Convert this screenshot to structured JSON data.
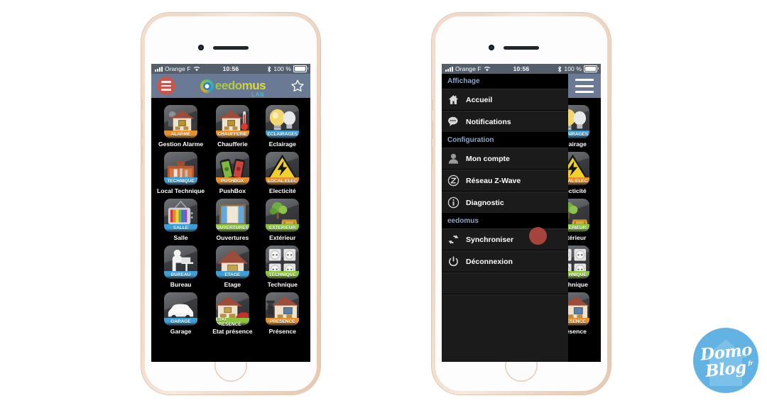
{
  "status_bar": {
    "carrier": "Orange F",
    "time": "10:56",
    "battery_pct": "100 %",
    "wifi_icon": "wifi-icon",
    "bluetooth_icon": "bluetooth-icon",
    "signal_icon": "signal-bars-icon",
    "battery_icon": "battery-icon"
  },
  "app_bar": {
    "menu_icon": "hamburger-menu-icon",
    "brand": "eedomus",
    "brand_sub": "LAN",
    "favorite_icon": "star-icon"
  },
  "colors": {
    "app_bar_bg": "#6b7a94",
    "status_bar_bg": "#555e6b",
    "menu_button_red": "#c7564f",
    "screen_bg": "#000000",
    "menu_row_bg": "#1b1b1b",
    "menu_section_text": "#8ea6c8",
    "touch_indicator": "#b0463e",
    "watermark_bg": "#62b2e4",
    "phone_body": "#f0dbca"
  },
  "tiles": [
    {
      "caption": "Gestion Alarme",
      "band": "ALARME",
      "band_color": "#e8902b",
      "art": "house-burglar-icon"
    },
    {
      "caption": "Chaufferie",
      "band": "CHAUFFERIE",
      "band_color": "#e8902b",
      "art": "house-thermometer-icon"
    },
    {
      "caption": "Eclairage",
      "band": "ECLAIRAGES",
      "band_color": "#3e9fd6",
      "art": "light-bulbs-icon"
    },
    {
      "caption": "Local Technique",
      "band": "TECHNIQUE",
      "band_color": "#3e9fd6",
      "art": "toolbox-icon"
    },
    {
      "caption": "PushBox",
      "band": "PUSHBOX",
      "band_color": "#e8902b",
      "art": "two-phones-icon"
    },
    {
      "caption": "Electicité",
      "band": "LOCAL ELEC",
      "band_color": "#e8902b",
      "art": "electricity-warning-icon"
    },
    {
      "caption": "Salle",
      "band": "SALLE",
      "band_color": "#3e9fd6",
      "art": "television-icon"
    },
    {
      "caption": "Ouvertures",
      "band": "OUVERTURES",
      "band_color": "#8cc63e",
      "art": "window-icon"
    },
    {
      "caption": "Extérieur",
      "band": "EXTERIEUR",
      "band_color": "#8cc63e",
      "art": "tree-picnic-icon"
    },
    {
      "caption": "Bureau",
      "band": "BUREAU",
      "band_color": "#3e9fd6",
      "art": "person-desk-icon"
    },
    {
      "caption": "Etage",
      "band": "ETAGE",
      "band_color": "#3e9fd6",
      "art": "house-roof-icon"
    },
    {
      "caption": "Technique",
      "band": "TECHNIQUE",
      "band_color": "#8cc63e",
      "art": "power-sockets-icon"
    },
    {
      "caption": "Garage",
      "band": "GARAGE",
      "band_color": "#3e9fd6",
      "art": "car-icon"
    },
    {
      "caption": "Etat présence",
      "band": "ETAT PRESENCE",
      "band_color": "#8cc63e",
      "art": "house-car-icon"
    },
    {
      "caption": "Présence",
      "band": "PRESENCE",
      "band_color": "#e8902b",
      "art": "house-person-icon"
    }
  ],
  "side_menu": {
    "sections": [
      {
        "title": "Affichage",
        "items": [
          {
            "label": "Accueil",
            "icon": "home-icon"
          },
          {
            "label": "Notifications",
            "icon": "chat-bubble-icon"
          }
        ]
      },
      {
        "title": "Configuration",
        "items": [
          {
            "label": "Mon compte",
            "icon": "user-icon"
          },
          {
            "label": "Réseau Z-Wave",
            "icon": "z-wave-icon"
          },
          {
            "label": "Diagnostic",
            "icon": "info-icon"
          }
        ]
      },
      {
        "title": "eedomus",
        "items": [
          {
            "label": "Synchroniser",
            "icon": "refresh-icon"
          },
          {
            "label": "Déconnexion",
            "icon": "power-icon"
          }
        ]
      }
    ]
  },
  "watermark": {
    "line1": "Domo",
    "line2": "Blog",
    "tld": "fr"
  }
}
